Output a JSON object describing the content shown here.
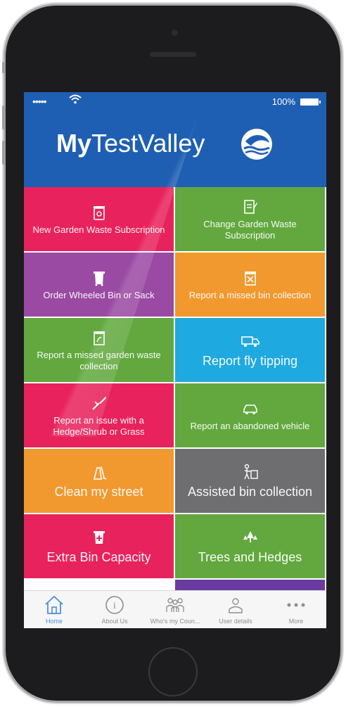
{
  "status_bar": {
    "signal": "•••••",
    "battery_text": "100%"
  },
  "header": {
    "brand_bold": "My",
    "brand_light": "TestValley",
    "logo_icon": "dolphin-wave-logo-icon"
  },
  "tiles": [
    {
      "label": "New Garden Waste Subscription",
      "icon": "garden-bin-icon",
      "color": "#e8225c"
    },
    {
      "label": "Change Garden Waste Subscription",
      "icon": "edit-document-icon",
      "color": "#62a83e"
    },
    {
      "label": "Order Wheeled Bin or Sack",
      "icon": "wheeled-bin-icon",
      "color": "#9a4aa3"
    },
    {
      "label": "Report a missed bin collection",
      "icon": "missed-bin-icon",
      "color": "#f1982e"
    },
    {
      "label": "Report a missed garden waste collection",
      "icon": "garden-waste-bin-icon",
      "color": "#62a83e"
    },
    {
      "label": "Report fly tipping",
      "icon": "truck-icon",
      "color": "#1fa9e1"
    },
    {
      "label": "Report an issue with a Hedge/Shrub or Grass",
      "icon": "hedge-trimmer-icon",
      "color": "#e8225c"
    },
    {
      "label": "Report an abandoned vehicle",
      "icon": "car-icon",
      "color": "#62a83e"
    },
    {
      "label": "Clean my street",
      "icon": "street-cleaning-icon",
      "color": "#f1982e"
    },
    {
      "label": "Assisted bin collection",
      "icon": "assisted-bin-icon",
      "color": "#6e6d70"
    },
    {
      "label": "Extra Bin Capacity",
      "icon": "extra-bin-icon",
      "color": "#e8225c"
    },
    {
      "label": "Trees and Hedges",
      "icon": "trees-icon",
      "color": "#62a83e"
    }
  ],
  "tabbar": {
    "items": [
      {
        "label": "Home",
        "icon": "home-icon",
        "active": true
      },
      {
        "label": "About Us",
        "icon": "info-icon",
        "active": false
      },
      {
        "label": "Who's my Coun...",
        "icon": "people-icon",
        "active": false
      },
      {
        "label": "User details",
        "icon": "user-icon",
        "active": false
      },
      {
        "label": "More",
        "icon": "more-icon",
        "active": false
      }
    ]
  },
  "colors": {
    "header_blue": "#1f5fb3",
    "tab_active": "#4a90d9"
  }
}
